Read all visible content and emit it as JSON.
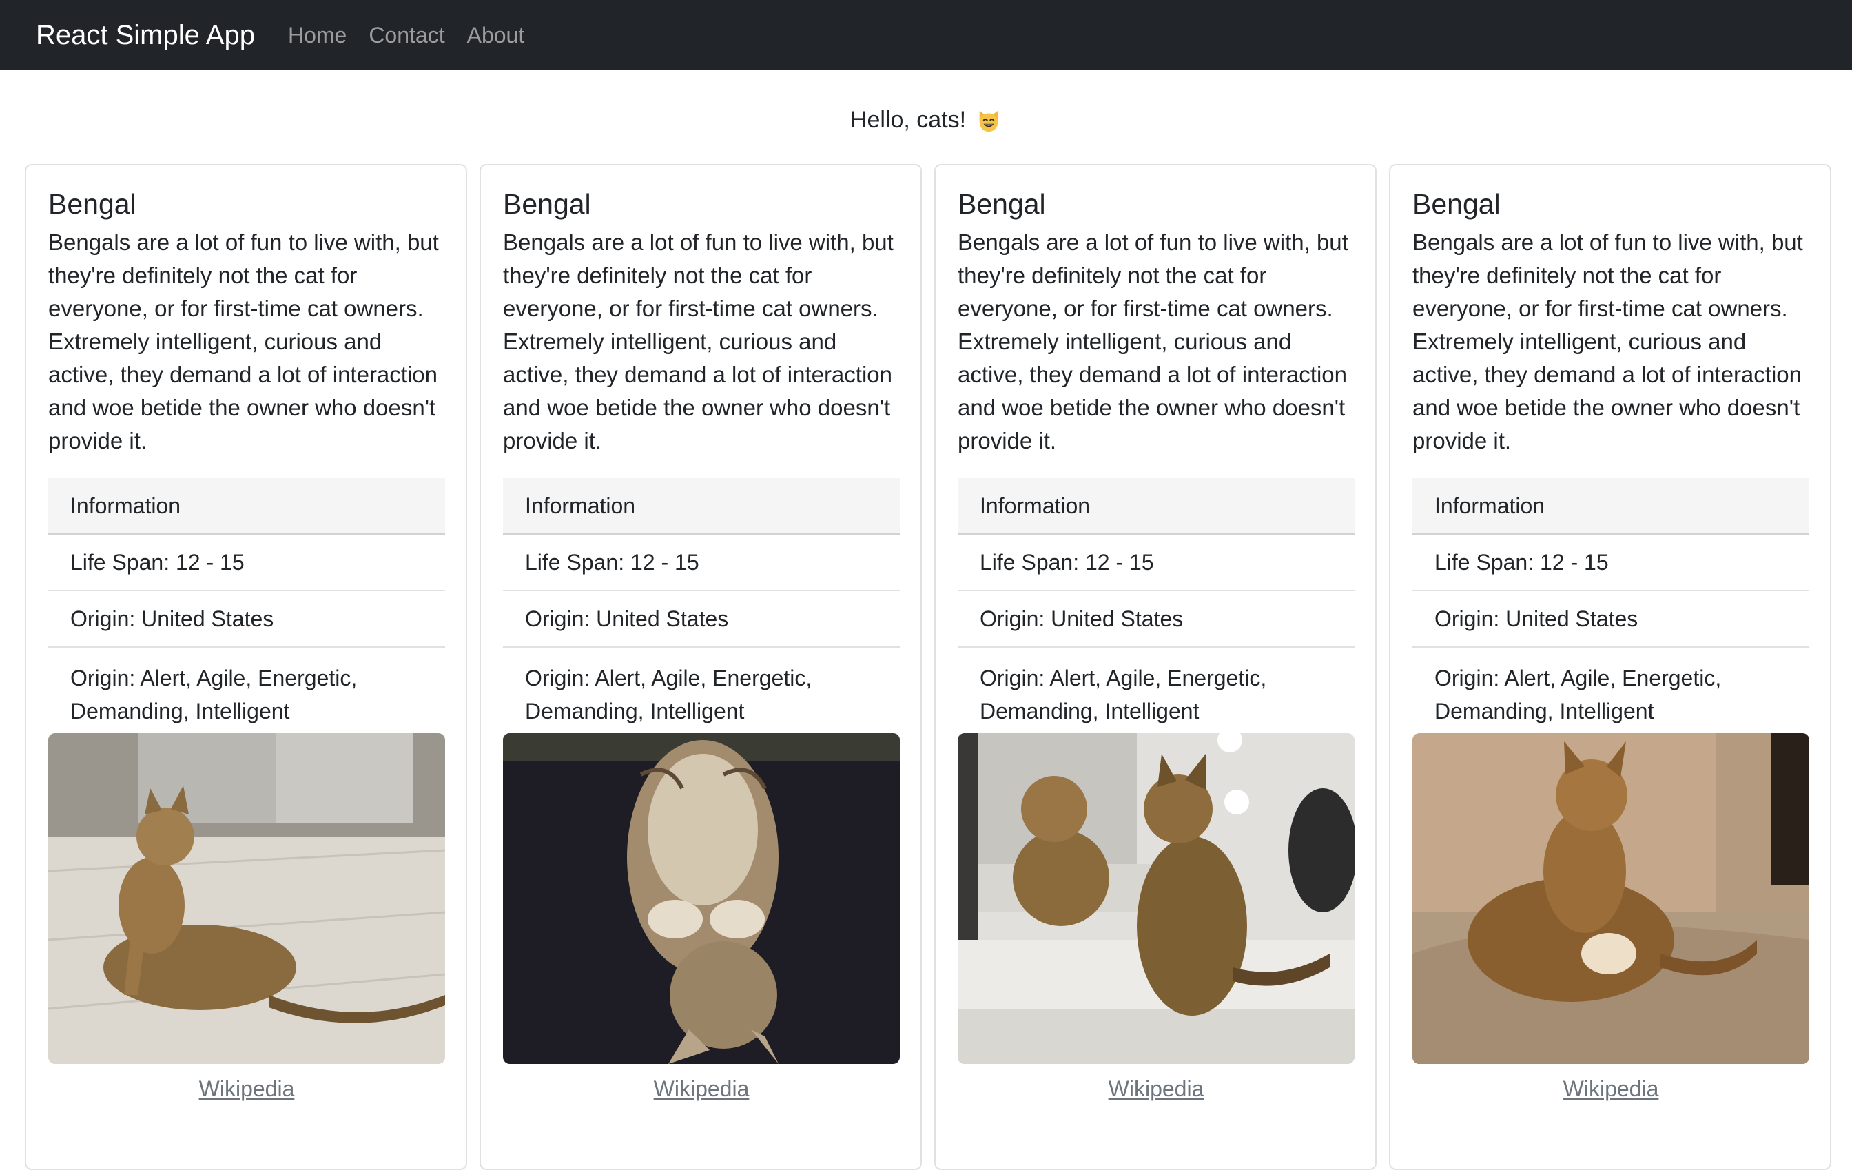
{
  "navbar": {
    "brand": "React Simple App",
    "links": [
      "Home",
      "Contact",
      "About"
    ]
  },
  "greeting": {
    "text": "Hello, cats!",
    "emoji": "smiling-cat-icon"
  },
  "cards": [
    {
      "title": "Bengal",
      "description": "Bengals are a lot of fun to live with, but they're definitely not the cat for everyone, or for first-time cat owners. Extremely intelligent, curious and active, they demand a lot of interaction and woe betide the owner who doesn't provide it.",
      "info_header": "Information",
      "life_span": "Life Span: 12 - 15",
      "origin": "Origin: United States",
      "temperament": "Origin: Alert, Agile, Energetic, Demanding, Intelligent",
      "link": "Wikipedia"
    },
    {
      "title": "Bengal",
      "description": "Bengals are a lot of fun to live with, but they're definitely not the cat for everyone, or for first-time cat owners. Extremely intelligent, curious and active, they demand a lot of interaction and woe betide the owner who doesn't provide it.",
      "info_header": "Information",
      "life_span": "Life Span: 12 - 15",
      "origin": "Origin: United States",
      "temperament": "Origin: Alert, Agile, Energetic, Demanding, Intelligent",
      "link": "Wikipedia"
    },
    {
      "title": "Bengal",
      "description": "Bengals are a lot of fun to live with, but they're definitely not the cat for everyone, or for first-time cat owners. Extremely intelligent, curious and active, they demand a lot of interaction and woe betide the owner who doesn't provide it.",
      "info_header": "Information",
      "life_span": "Life Span: 12 - 15",
      "origin": "Origin: United States",
      "temperament": "Origin: Alert, Agile, Energetic, Demanding, Intelligent",
      "link": "Wikipedia"
    },
    {
      "title": "Bengal",
      "description": "Bengals are a lot of fun to live with, but they're definitely not the cat for everyone, or for first-time cat owners. Extremely intelligent, curious and active, they demand a lot of interaction and woe betide the owner who doesn't provide it.",
      "info_header": "Information",
      "life_span": "Life Span: 12 - 15",
      "origin": "Origin: United States",
      "temperament": "Origin: Alert, Agile, Energetic, Demanding, Intelligent",
      "link": "Wikipedia"
    }
  ],
  "colors": {
    "navbar_bg": "#212529",
    "brand": "#ffffff",
    "nav_link": "#9a9da0",
    "card_border": "#dfe1e4",
    "list_header_bg": "#f5f5f5",
    "link": "#6c757d"
  }
}
